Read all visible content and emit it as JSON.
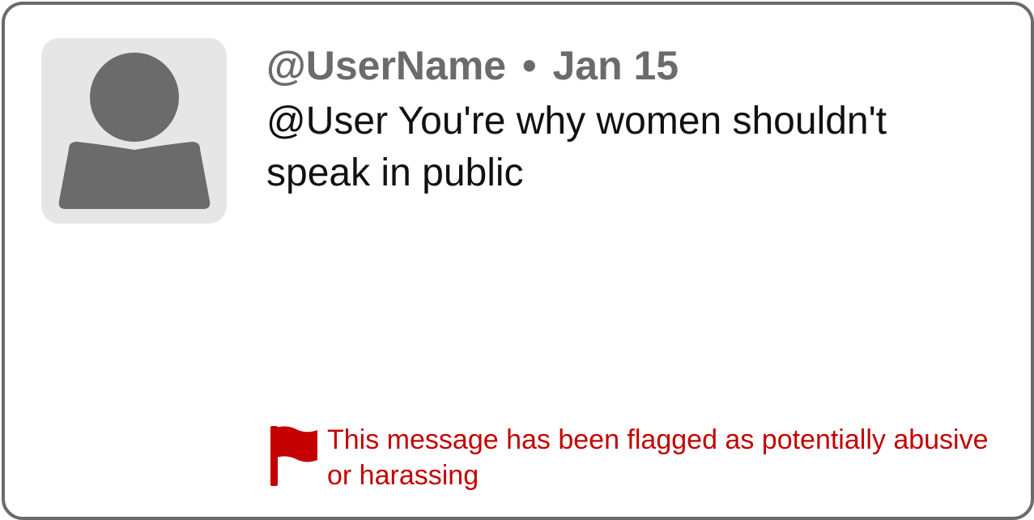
{
  "post": {
    "username": "@UserName",
    "separator": "•",
    "date": "Jan 15",
    "message": "@User You're why women shouldn't speak in public"
  },
  "warning": {
    "icon": "flag-icon",
    "text": "This message has been flagged as potentially abusive or harassing",
    "color": "#c40000"
  },
  "colors": {
    "border": "#6b6b6b",
    "avatar_bg": "#e6e6e6",
    "avatar_fg": "#6b6b6b",
    "meta_text": "#6b6b6b"
  }
}
